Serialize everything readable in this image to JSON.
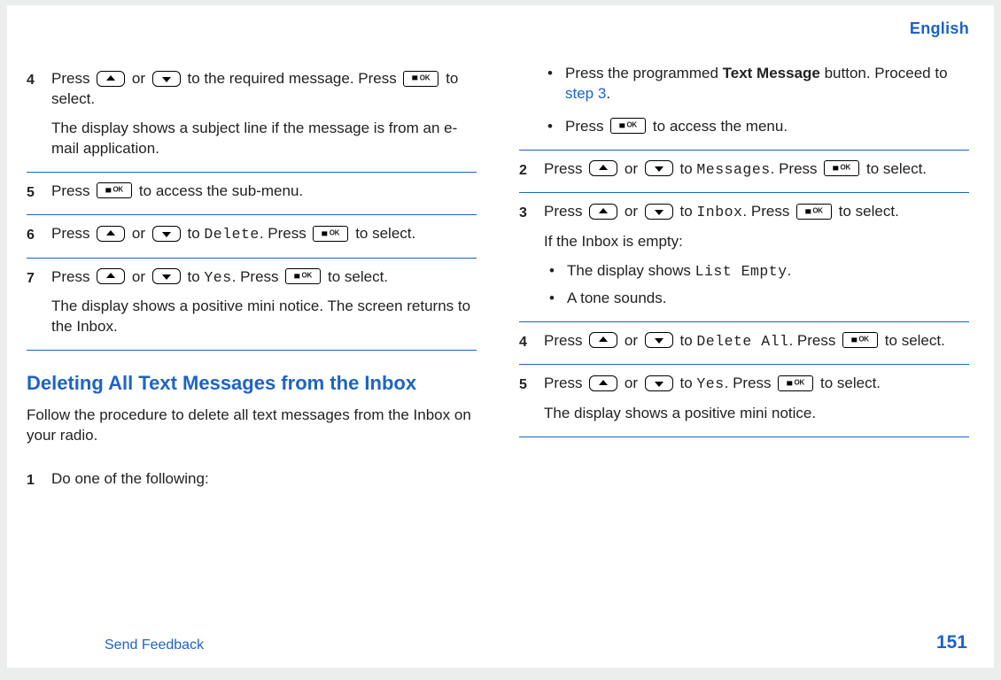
{
  "header": {
    "language": "English"
  },
  "left": {
    "step4": {
      "num": "4",
      "p1_a": "Press ",
      "p1_b": " or ",
      "p1_c": " to the required message. Press ",
      "p1_d": " to select.",
      "p2": "The display shows a subject line if the message is from an e-mail application."
    },
    "step5": {
      "num": "5",
      "p1_a": "Press ",
      "p1_b": " to access the sub-menu."
    },
    "step6": {
      "num": "6",
      "p1_a": "Press ",
      "p1_b": " or ",
      "p1_c": " to ",
      "mono": "Delete",
      "p1_d": ". Press ",
      "p1_e": " to select."
    },
    "step7": {
      "num": "7",
      "p1_a": "Press ",
      "p1_b": " or ",
      "p1_c": " to ",
      "mono": "Yes",
      "p1_d": ". Press ",
      "p1_e": " to select.",
      "p2": "The display shows a positive mini notice. The screen returns to the Inbox."
    },
    "section_title": "Deleting All Text Messages from the Inbox",
    "section_intro": "Follow the procedure to delete all text messages from the Inbox on your radio.",
    "step1": {
      "num": "1",
      "p1": "Do one of the following:"
    }
  },
  "right": {
    "bullets": {
      "b1_a": "Press the programmed ",
      "b1_bold": "Text Message",
      "b1_b": " button. Proceed to ",
      "b1_link": "step 3",
      "b1_c": ".",
      "b2_a": "Press ",
      "b2_b": " to access the menu."
    },
    "step2": {
      "num": "2",
      "p1_a": "Press ",
      "p1_b": " or ",
      "p1_c": " to ",
      "mono": "Messages",
      "p1_d": ". Press ",
      "p1_e": " to select."
    },
    "step3": {
      "num": "3",
      "p1_a": "Press ",
      "p1_b": " or ",
      "p1_c": " to ",
      "mono": "Inbox",
      "p1_d": ". Press ",
      "p1_e": " to select.",
      "p2": "If the Inbox is empty:",
      "sub_b1_a": "The display shows ",
      "sub_b1_mono": "List Empty",
      "sub_b1_b": ".",
      "sub_b2": "A tone sounds."
    },
    "step4": {
      "num": "4",
      "p1_a": "Press ",
      "p1_b": " or ",
      "p1_c": " to ",
      "mono": "Delete All",
      "p1_d": ". Press ",
      "p1_e": " to select."
    },
    "step5": {
      "num": "5",
      "p1_a": "Press ",
      "p1_b": " or ",
      "p1_c": " to ",
      "mono": "Yes",
      "p1_d": ". Press ",
      "p1_e": " to select.",
      "p2": "The display shows a positive mini notice."
    }
  },
  "footer": {
    "feedback": "Send Feedback",
    "page": "151"
  },
  "icons": {
    "ok_text": "OK"
  }
}
